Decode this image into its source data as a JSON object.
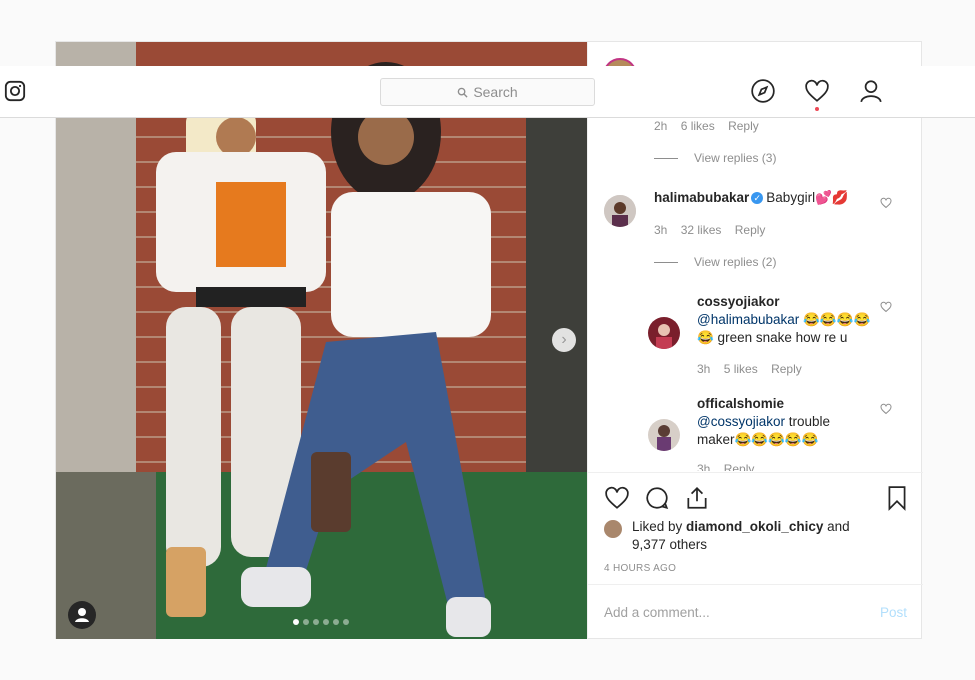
{
  "nav": {
    "search_placeholder": "Search",
    "icons": [
      "instagram-logo-icon",
      "compass-icon",
      "heart-icon",
      "profile-icon"
    ]
  },
  "comments": {
    "thread1_meta": {
      "time": "2h",
      "likes": "6 likes",
      "reply": "Reply"
    },
    "thread1_view_replies": "View replies (3)",
    "c2": {
      "user": "halimabubakar",
      "text": "Babygirl💕💋",
      "time": "3h",
      "likes": "32 likes",
      "reply": "Reply",
      "view_replies": "View replies (2)"
    },
    "r1": {
      "user": "cossyojiakor",
      "mention": "@halimabubakar",
      "text_after": " 😂😂😂😂",
      "line2": "😂 green snake how re u",
      "time": "3h",
      "likes": "5 likes",
      "reply": "Reply"
    },
    "r2": {
      "user": "officalshomie",
      "mention": "@cossyojiakor",
      "text_after": " trouble",
      "line2": "maker😂😂😂😂😂",
      "time": "3h",
      "reply": "Reply"
    }
  },
  "actions": {
    "liked_prefix": "Liked by ",
    "liked_user": "diamond_okoli_chicy",
    "liked_mid": " and",
    "liked_others": "9,377 others",
    "timestamp": "4 HOURS AGO"
  },
  "add_comment": {
    "placeholder": "Add a comment...",
    "post_label": "Post"
  },
  "carousel": {
    "dots": 6,
    "active": 1
  },
  "colors": {
    "link": "#003569",
    "verified": "#3897f0",
    "notify": "#ed4956",
    "post_disabled": "#b2dffc"
  }
}
